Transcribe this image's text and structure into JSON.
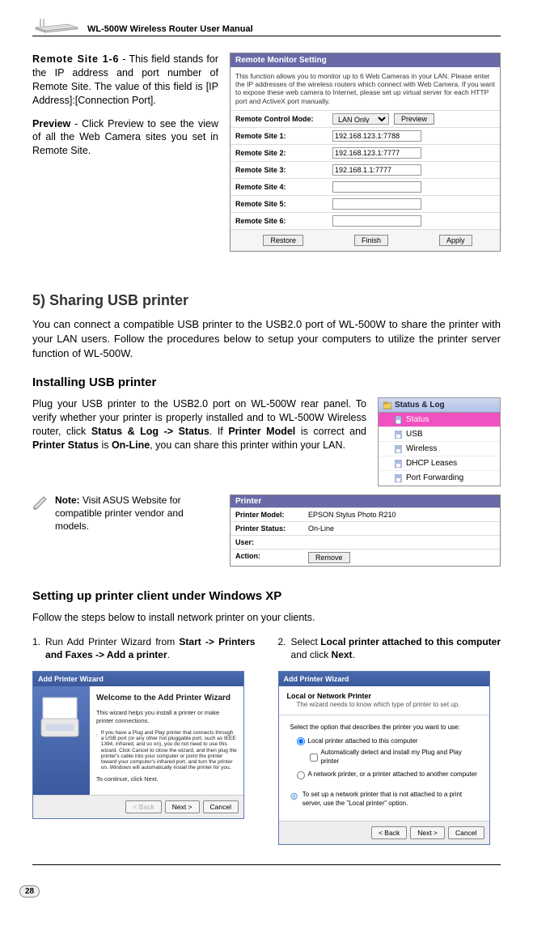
{
  "header": {
    "manual_title": "WL-500W Wireless Router User Manual"
  },
  "top_text": {
    "p1_bold": "Remote Site 1-6",
    "p1_rest": " - This field stands for the IP address and port number of Remote Site. The value of this field is [IP Address]:[Connection Port].",
    "p2_bold": "Preview",
    "p2_rest": " - Click Preview to see the view of all the Web Camera sites you set in Remote Site."
  },
  "remote_panel": {
    "title": "Remote Monitor Setting",
    "desc": "This function allows you to monitor up to 6 Web Cameras in your LAN. Please enter the IP addresses of the wireless routers which connect with Web Camera. If you want to expose these web camera to Internet, please set up virtual server for each HTTP port and ActiveX port manually.",
    "mode_label": "Remote Control Mode:",
    "mode_value": "LAN Only",
    "preview_btn": "Preview",
    "rows": [
      {
        "label": "Remote Site 1:",
        "value": "192.168.123.1:7788"
      },
      {
        "label": "Remote Site 2:",
        "value": "192.168.123.1:7777"
      },
      {
        "label": "Remote Site 3:",
        "value": "192.168.1.1:7777"
      },
      {
        "label": "Remote Site 4:",
        "value": ""
      },
      {
        "label": "Remote Site 5:",
        "value": ""
      },
      {
        "label": "Remote Site 6:",
        "value": ""
      }
    ],
    "restore": "Restore",
    "finish": "Finish",
    "apply": "Apply"
  },
  "section5": {
    "heading": "5) Sharing USB printer",
    "body": "You can connect a compatible USB printer to the USB2.0 port of WL-500W to share the printer with your LAN users. Follow the procedures below to setup your computers to utilize the printer server function of WL-500W."
  },
  "install": {
    "heading": "Installing USB printer",
    "body_a": "Plug your USB printer to the USB2.0 port on WL-500W rear panel. To verify whether your printer is properly installed and to WL-500W Wireless router, click ",
    "body_b_bold": "Status & Log -> Status",
    "body_c": ". If ",
    "body_d_bold": "Printer Model",
    "body_e": " is correct and ",
    "body_f_bold": "Printer Status",
    "body_g": " is ",
    "body_h_bold": "On-Line",
    "body_i": ", you can share this printer within your LAN."
  },
  "status_menu": {
    "head": "Status & Log",
    "items": [
      "Status",
      "USB",
      "Wireless",
      "DHCP Leases",
      "Port Forwarding"
    ]
  },
  "note": {
    "label": "Note:",
    "text": " Visit ASUS Website for compatible printer vendor and models."
  },
  "printer_panel": {
    "title": "Printer",
    "model_label": "Printer Model:",
    "model_value": "EPSON Stylus Photo R210",
    "status_label": "Printer Status:",
    "status_value": "On-Line",
    "user_label": "User:",
    "user_value": "",
    "action_label": "Action:",
    "remove_btn": "Remove"
  },
  "setup": {
    "heading": "Setting up printer client under Windows XP",
    "intro": "Follow the steps below to install network printer on your clients."
  },
  "step1": {
    "num": "1.",
    "text_a": "Run Add Printer Wizard from ",
    "text_b_bold": "Start -> Printers and Faxes -> Add a printer",
    "text_c": "."
  },
  "step2": {
    "num": "2.",
    "text_a": "Select ",
    "text_b_bold": "Local printer attached to this computer",
    "text_c": " and click ",
    "text_d_bold": "Next",
    "text_e": "."
  },
  "wiz1": {
    "title": "Add Printer Wizard",
    "welcome": "Welcome to the Add Printer Wizard",
    "line1": "This wizard helps you install a printer or make printer connections.",
    "info": "If you have a Plug and Play printer that connects through a USB port (or any other hot pluggable port, such as IEEE 1394, infrared, and so on), you do not need to use this wizard. Click Cancel to close the wizard, and then plug the printer's cable into your computer or point the printer toward your computer's infrared port, and turn the printer on. Windows will automatically install the printer for you.",
    "cont": "To continue, click Next.",
    "back": "< Back",
    "next": "Next >",
    "cancel": "Cancel"
  },
  "wiz2": {
    "title": "Add Printer Wizard",
    "head": "Local or Network Printer",
    "sub": "The wizard needs to know which type of printer to set up.",
    "prompt": "Select the option that describes the printer you want to use:",
    "opt1": "Local printer attached to this computer",
    "chk": "Automatically detect and install my Plug and Play printer",
    "opt2": "A network printer, or a printer attached to another computer",
    "tip": "To set up a network printer that is not attached to a print server, use the \"Local printer\" option.",
    "back": "< Back",
    "next": "Next >",
    "cancel": "Cancel"
  },
  "page_number": "28"
}
